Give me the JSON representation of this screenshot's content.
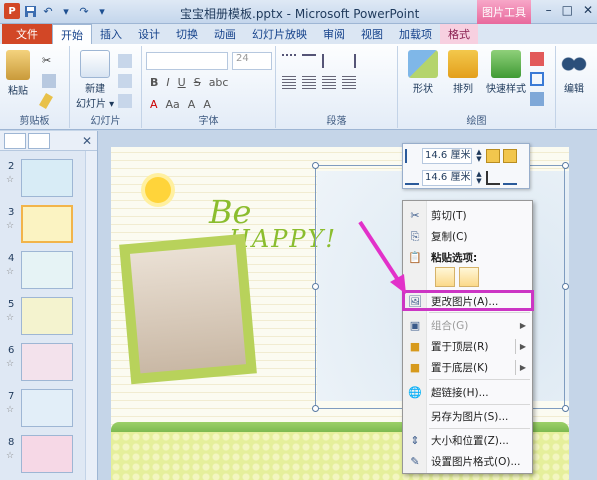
{
  "window": {
    "title": "宝宝相册模板.pptx - Microsoft PowerPoint",
    "context_tab_header": "图片工具",
    "controls": [
      "–",
      "□",
      "✕"
    ]
  },
  "tabs": [
    "文件",
    "开始",
    "插入",
    "设计",
    "切换",
    "动画",
    "幻灯片放映",
    "审阅",
    "视图",
    "加载项",
    "格式"
  ],
  "ribbon": {
    "groups": {
      "clipboard": "剪贴板",
      "slides": "幻灯片",
      "font": "字体",
      "paragraph": "段落",
      "drawing": "绘图"
    },
    "paste_label": "粘贴",
    "new_slide_label": "新建\n幻灯片",
    "new_slide_line1": "新建",
    "new_slide_line2": "幻灯片 ▾",
    "font_size": "24",
    "shapes_label": "形状",
    "arrange_label": "排列",
    "quick_styles_label": "快速样式",
    "edit_label": "编辑"
  },
  "thumbnails": [
    {
      "num": "2",
      "star": "☆",
      "color": "#d8ecf6"
    },
    {
      "num": "3",
      "star": "☆",
      "color": "#fbf3c2"
    },
    {
      "num": "4",
      "star": "☆",
      "color": "#e6f3f5"
    },
    {
      "num": "5",
      "star": "☆",
      "color": "#f4f3cf"
    },
    {
      "num": "6",
      "star": "☆",
      "color": "#f3e2ec"
    },
    {
      "num": "7",
      "star": "☆",
      "color": "#e2eef8"
    },
    {
      "num": "8",
      "star": "☆",
      "color": "#f6d8e6"
    }
  ],
  "slide": {
    "be_text": "Be",
    "happy_text": "HAPPY!"
  },
  "minibar": {
    "height": "14.6 厘米",
    "width": "14.6 厘米"
  },
  "context_menu": {
    "cut": "剪切(T)",
    "copy": "复制(C)",
    "paste_options": "粘贴选项:",
    "change_picture": "更改图片(A)...",
    "group": "组合(G)",
    "bring_front": "置于顶层(R)",
    "send_back": "置于底层(K)",
    "hyperlink": "超链接(H)...",
    "save_as_picture": "另存为图片(S)...",
    "size_position": "大小和位置(Z)...",
    "format_picture": "设置图片格式(O)..."
  },
  "colors": {
    "file_tab": "#d24726",
    "context_tab": "#e8689c",
    "highlight": "#cc35c4",
    "selected_thumb": "#f2b44a"
  }
}
